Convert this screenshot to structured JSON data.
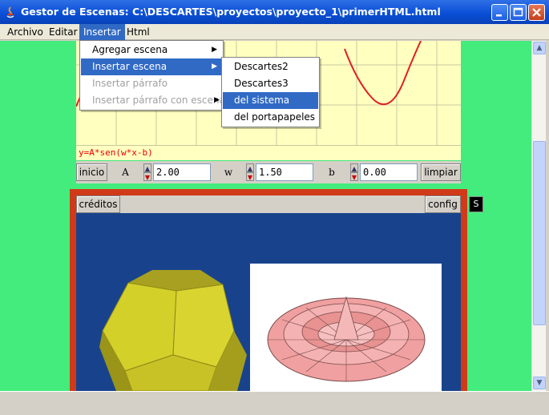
{
  "window": {
    "title": "Gestor de Escenas: C:\\DESCARTES\\proyectos\\proyecto_1\\primerHTML.html"
  },
  "menubar": {
    "items": [
      "Archivo",
      "Editar",
      "Insertar",
      "Html"
    ],
    "active": "Insertar"
  },
  "insert_menu": {
    "items": [
      {
        "label": "Agregar escena",
        "enabled": true,
        "submenu": true
      },
      {
        "label": "Insertar escena",
        "enabled": true,
        "submenu": true,
        "highlighted": true
      },
      {
        "label": "Insertar párrafo",
        "enabled": false,
        "submenu": false
      },
      {
        "label": "Insertar párrafo con escena",
        "enabled": false,
        "submenu": true
      }
    ]
  },
  "scene_submenu": {
    "items": [
      {
        "label": "Descartes2"
      },
      {
        "label": "Descartes3"
      },
      {
        "label": "del sistema",
        "highlighted": true
      },
      {
        "label": "del portapapeles"
      }
    ]
  },
  "scene1": {
    "formula": "y=A*sen(w*x-b)",
    "reset_label": "inicio",
    "clear_label": "limpiar",
    "params": [
      {
        "name": "A",
        "value": "2.00"
      },
      {
        "name": "w",
        "value": "1.50"
      },
      {
        "name": "b",
        "value": "0.00"
      }
    ]
  },
  "scene2": {
    "credits_label": "créditos",
    "config_label": "config",
    "s_label": "S"
  },
  "colors": {
    "background": "#43ec7c",
    "graph_bg": "#ffffc0",
    "curve": "#e02020",
    "scene_border": "#d03a18",
    "scene_bg": "#18438c",
    "highlight": "#316ac5"
  },
  "icons": [
    "app-java-icon",
    "minimize-icon",
    "maximize-icon",
    "close-icon",
    "scroll-up-icon",
    "scroll-down-icon",
    "submenu-arrow-icon",
    "spin-up-icon",
    "spin-down-icon"
  ]
}
